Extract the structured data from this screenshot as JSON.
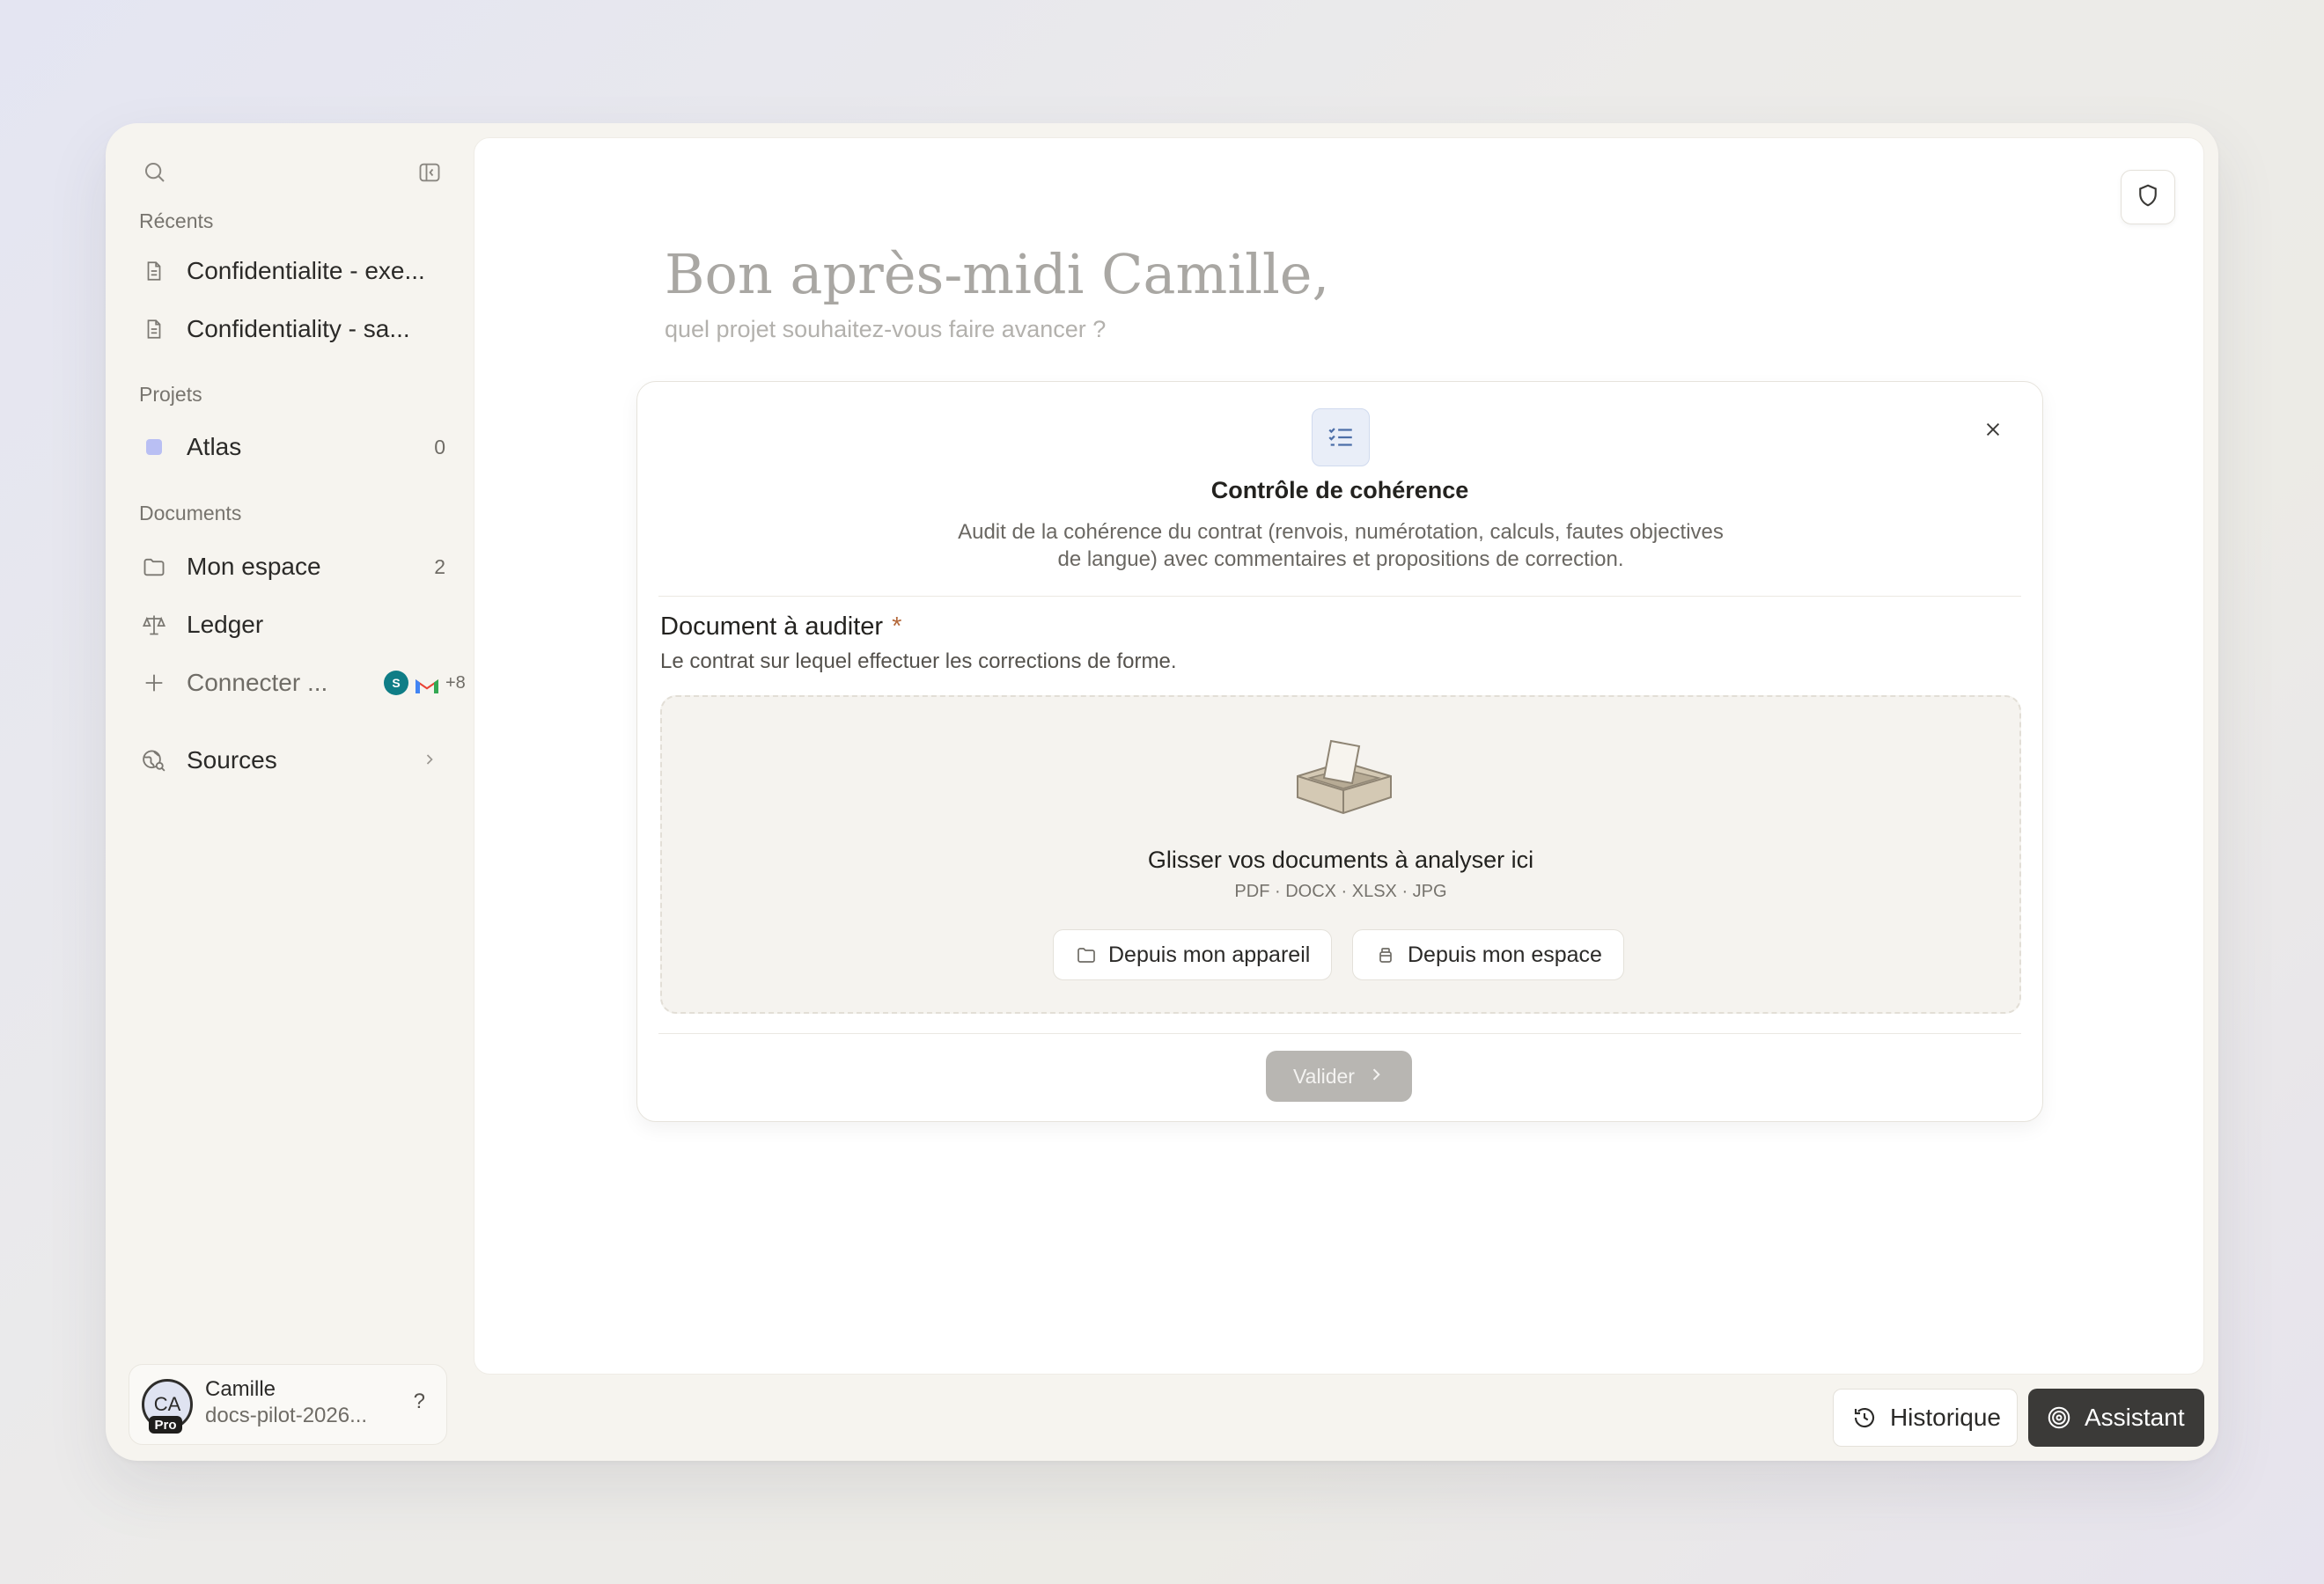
{
  "sidebar": {
    "sections": {
      "recents": "Récents",
      "projects": "Projets",
      "documents": "Documents"
    },
    "recents": [
      {
        "label": "Confidentialite - exe...",
        "icon": "document-icon"
      },
      {
        "label": "Confidentiality - sa...",
        "icon": "document-icon"
      }
    ],
    "projects": [
      {
        "label": "Atlas",
        "count": "0",
        "color": "#b9bff3"
      }
    ],
    "documents": [
      {
        "label": "Mon espace",
        "count": "2",
        "icon": "folder-icon"
      },
      {
        "label": "Ledger",
        "icon": "scale-icon"
      },
      {
        "label": "Connecter ...",
        "icon": "plus-icon",
        "extra": "+8",
        "connectors": [
          "sharepoint-icon",
          "gmail-icon"
        ]
      }
    ],
    "sources": {
      "label": "Sources",
      "icon": "globe-search-icon"
    },
    "user": {
      "initials": "CA",
      "badge": "Pro",
      "name": "Camille",
      "org": "docs-pilot-2026...",
      "help": "?"
    }
  },
  "main": {
    "greeting": "Bon après-midi Camille,",
    "subtitle": "quel projet souhaitez-vous faire avancer ?",
    "workflow": {
      "title": "Contrôle de cohérence",
      "description": "Audit de la cohérence du contrat (renvois, numérotation, calculs, fautes objectives de langue) avec commentaires et propositions de correction.",
      "field_label": "Document à auditer",
      "required_mark": "*",
      "field_help": "Le contrat sur lequel effectuer les corrections de forme.",
      "dropzone_title": "Glisser vos documents à analyser ici",
      "dropzone_formats": "PDF · DOCX · XLSX · JPG",
      "btn_device": "Depuis mon appareil",
      "btn_space": "Depuis mon espace",
      "validate": "Valider"
    }
  },
  "footer": {
    "history": "Historique",
    "assistant": "Assistant"
  }
}
